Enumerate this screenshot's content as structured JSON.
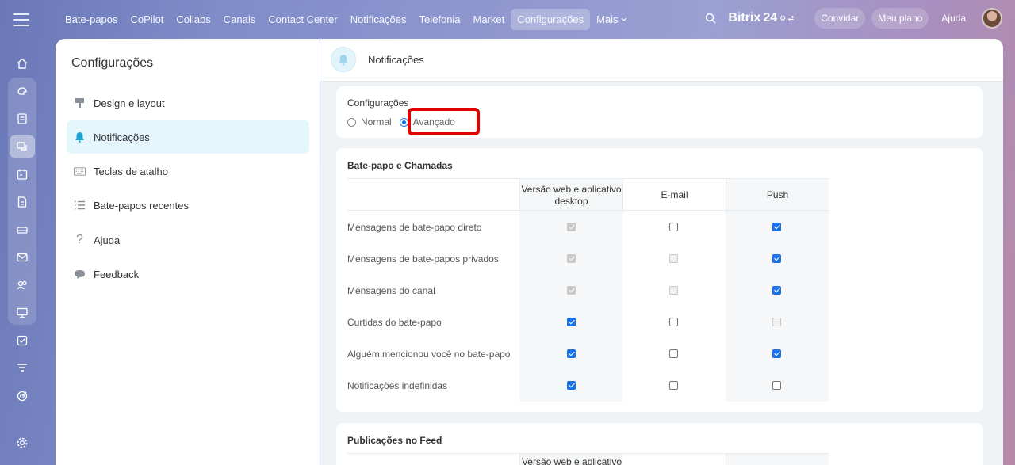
{
  "topnav": {
    "items": [
      "Bate-papos",
      "CoPilot",
      "Collabs",
      "Canais",
      "Contact Center",
      "Notificações",
      "Telefonia",
      "Market",
      "Configurações"
    ],
    "active_index": 8,
    "more_label": "Mais",
    "brand": "Bitrix",
    "brand_num": "24",
    "invite_label": "Convidar",
    "plan_label": "Meu plano",
    "help_label": "Ajuda"
  },
  "settings_menu": {
    "title": "Configurações",
    "items": [
      {
        "label": "Design e layout",
        "icon": "brush-icon"
      },
      {
        "label": "Notificações",
        "icon": "bell-icon"
      },
      {
        "label": "Teclas de atalho",
        "icon": "keyboard-icon"
      },
      {
        "label": "Bate-papos recentes",
        "icon": "list-icon"
      },
      {
        "label": "Ajuda",
        "icon": "question-icon"
      },
      {
        "label": "Feedback",
        "icon": "speech-bubble-icon"
      }
    ],
    "active_index": 1
  },
  "content": {
    "header_title": "Notificações",
    "mode": {
      "label": "Configurações",
      "options": [
        "Normal",
        "Avançado"
      ],
      "selected": "Avançado"
    },
    "chat_section": {
      "title": "Bate-papo e Chamadas",
      "columns": [
        "Versão web e aplicativo desktop",
        "E-mail",
        "Push"
      ],
      "rows": [
        {
          "label": "Mensagens de bate-papo direto",
          "web": "checked-disabled",
          "email": "unchecked",
          "push": "checked"
        },
        {
          "label": "Mensagens de bate-papos privados",
          "web": "checked-disabled",
          "email": "disabled",
          "push": "checked"
        },
        {
          "label": "Mensagens do canal",
          "web": "checked-disabled",
          "email": "disabled",
          "push": "checked"
        },
        {
          "label": "Curtidas do bate-papo",
          "web": "checked",
          "email": "unchecked",
          "push": "disabled"
        },
        {
          "label": "Alguém mencionou você no bate-papo",
          "web": "checked",
          "email": "unchecked",
          "push": "checked"
        },
        {
          "label": "Notificações indefinidas",
          "web": "checked",
          "email": "unchecked",
          "push": "unchecked"
        }
      ]
    },
    "feed_section": {
      "title": "Publicações no Feed",
      "column_partial": "Versão web e aplicativo"
    }
  }
}
